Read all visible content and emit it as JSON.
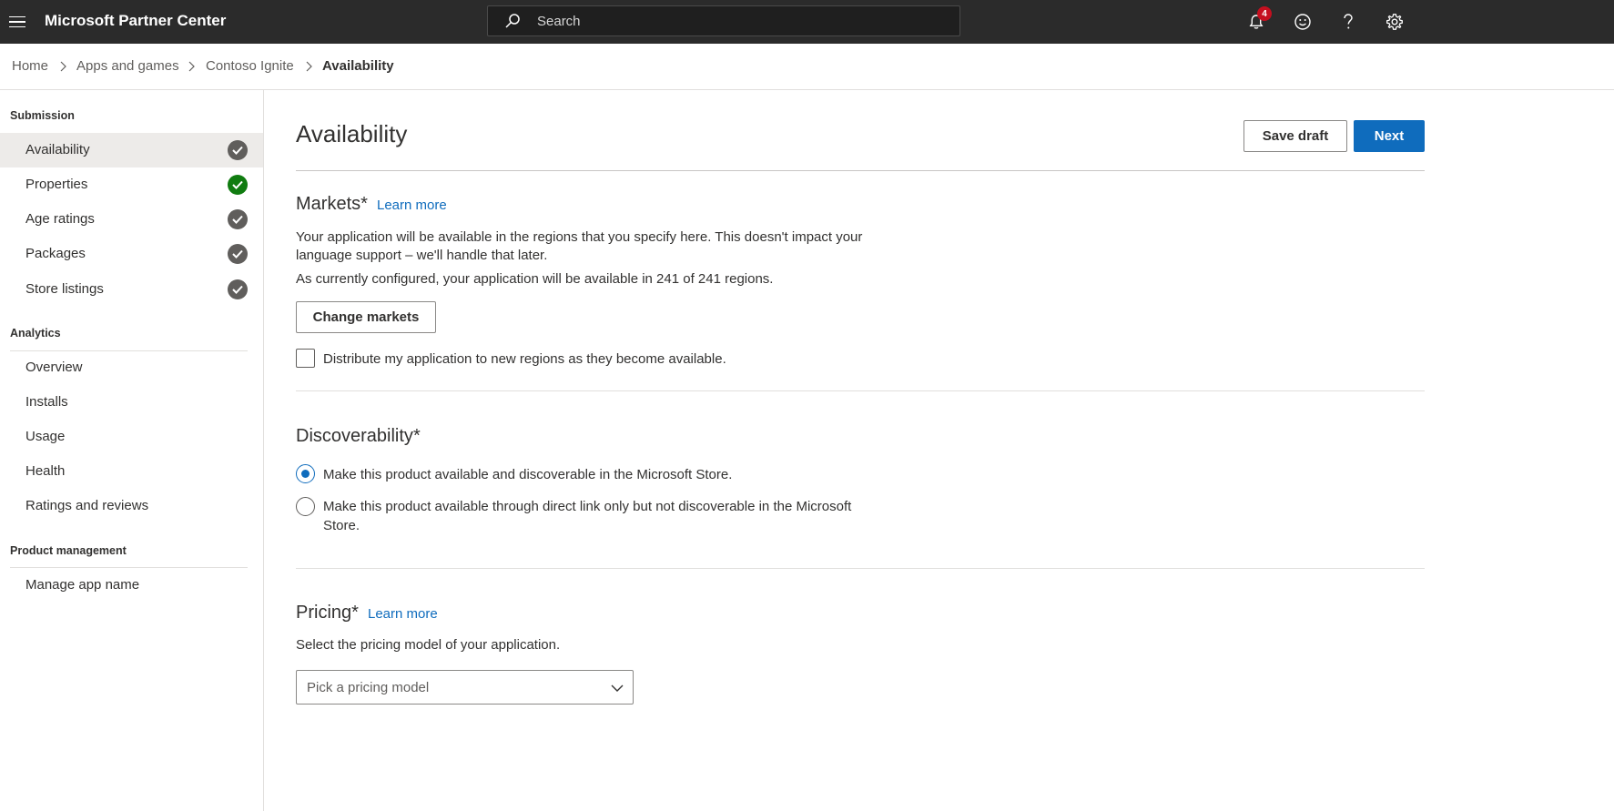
{
  "header": {
    "title": "Microsoft Partner Center",
    "search_placeholder": "Search",
    "notification_count": "4",
    "icons": [
      "hamburger-menu-icon",
      "search-icon",
      "bell-icon",
      "smiley-icon",
      "help-icon",
      "gear-icon"
    ]
  },
  "breadcrumb": {
    "items": [
      "Home",
      "Apps and games",
      "Contoso Ignite",
      "Availability"
    ]
  },
  "sidebar": {
    "submission_heading": "Submission",
    "submission_items": [
      {
        "label": "Availability",
        "status": "complete"
      },
      {
        "label": "Properties",
        "status": "complete-success"
      },
      {
        "label": "Age ratings",
        "status": "complete"
      },
      {
        "label": "Packages",
        "status": "complete"
      },
      {
        "label": "Store listings",
        "status": "complete"
      }
    ],
    "analytics_heading": "Analytics",
    "analytics_items": [
      "Overview",
      "Installs",
      "Usage",
      "Health",
      "Ratings and reviews"
    ],
    "product_heading": "Product management",
    "product_items": [
      "Manage app name"
    ]
  },
  "main": {
    "title": "Availability",
    "save_draft_label": "Save draft",
    "next_label": "Next",
    "markets": {
      "title": "Markets",
      "required": "*",
      "learn_more": "Learn more",
      "description_line1": "Your application will be available in the regions that you specify here. This doesn't impact your",
      "description_line2": "language support – we'll handle that later.",
      "status": "As currently configured, your application will be available in 241 of 241 regions.",
      "change_markets_label": "Change markets",
      "distribute_label": "Distribute my application to new regions as they become available.",
      "distribute_checked": false
    },
    "discoverability": {
      "title": "Discoverability",
      "required": "*",
      "option1_label": "Make this product available and discoverable in the Microsoft Store.",
      "option2_line1": "Make this product available through direct link only but not discoverable in the Microsoft",
      "option2_line2": "Store.",
      "selected": "option1"
    },
    "pricing": {
      "title": "Pricing",
      "required": "*",
      "learn_more": "Learn more",
      "description": "Select the pricing model of your application.",
      "dropdown_placeholder": "Pick a pricing model"
    }
  },
  "colors": {
    "topbar": "#2b2b2b",
    "accent": "#0f6cbd",
    "success": "#107c10",
    "status_neutral": "#605e5c",
    "badge": "#c50f1f"
  }
}
